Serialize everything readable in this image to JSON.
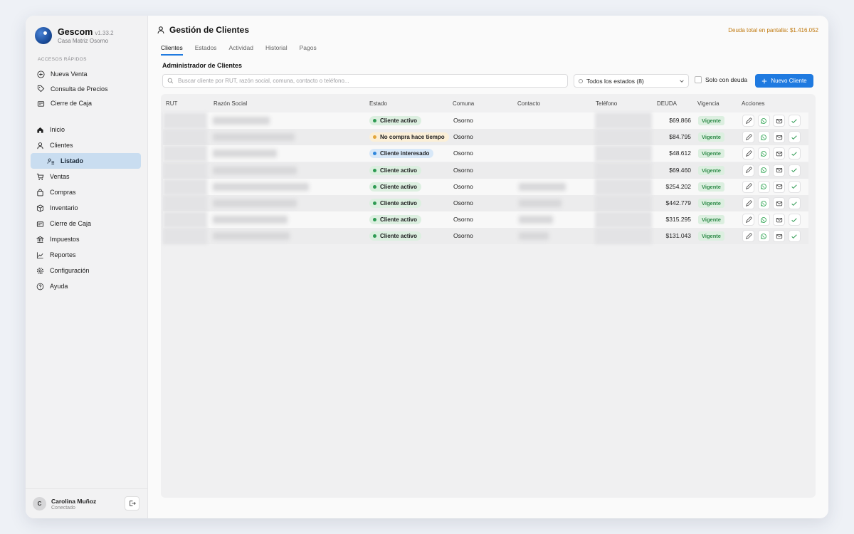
{
  "app": {
    "name": "Gescom",
    "version": "v1.33.2",
    "branch": "Casa Matriz Osorno"
  },
  "quick_access": {
    "title": "ACCESOS RÁPIDOS",
    "items": [
      {
        "label": "Nueva Venta",
        "icon": "plus-circle-icon"
      },
      {
        "label": "Consulta de Precios",
        "icon": "tag-icon"
      },
      {
        "label": "Cierre de Caja",
        "icon": "cash-register-icon"
      }
    ]
  },
  "nav": {
    "items": [
      {
        "label": "Inicio",
        "icon": "home-icon"
      },
      {
        "label": "Clientes",
        "icon": "user-icon"
      },
      {
        "label": "Listado",
        "icon": "users-list-icon",
        "active": true
      },
      {
        "label": "Ventas",
        "icon": "cart-icon"
      },
      {
        "label": "Compras",
        "icon": "shopping-bag-icon"
      },
      {
        "label": "Inventario",
        "icon": "box-icon"
      },
      {
        "label": "Cierre de Caja",
        "icon": "cash-register-icon"
      },
      {
        "label": "Impuestos",
        "icon": "bank-icon"
      },
      {
        "label": "Reportes",
        "icon": "chart-line-icon"
      },
      {
        "label": "Configuración",
        "icon": "gear-icon"
      },
      {
        "label": "Ayuda",
        "icon": "help-circle-icon"
      }
    ]
  },
  "user": {
    "initial": "C",
    "name": "Carolina Muñoz",
    "status": "Conectado"
  },
  "header": {
    "title": "Gestión de Clientes",
    "debt_total": "Deuda total en pantalla: $1.416.052",
    "tabs": [
      "Clientes",
      "Estados",
      "Actividad",
      "Historial",
      "Pagos"
    ],
    "active_tab": "Clientes"
  },
  "toolbar": {
    "subtitle": "Administrador de Clientes",
    "search_placeholder": "Buscar cliente por RUT, razón social, comuna, contacto o teléfono...",
    "status_filter": "Todos los estados (8)",
    "debt_only_label": "Solo con deuda",
    "new_button": "Nuevo Cliente"
  },
  "table": {
    "columns": [
      "RUT",
      "Razón Social",
      "Estado",
      "Comuna",
      "Contacto",
      "Teléfono",
      "DEUDA",
      "Vigencia",
      "Acciones"
    ],
    "rows": [
      {
        "estado": "Cliente activo",
        "estado_kind": "activo",
        "comuna": "Osorno",
        "deuda": "$69.866",
        "vigencia": "Vigente"
      },
      {
        "estado": "No compra hace tiempo",
        "estado_kind": "nocompra",
        "comuna": "Osorno",
        "deuda": "$84.795",
        "vigencia": "Vigente"
      },
      {
        "estado": "Cliente interesado",
        "estado_kind": "interes",
        "comuna": "Osorno",
        "deuda": "$48.612",
        "vigencia": "Vigente"
      },
      {
        "estado": "Cliente activo",
        "estado_kind": "activo",
        "comuna": "Osorno",
        "deuda": "$69.460",
        "vigencia": "Vigente"
      },
      {
        "estado": "Cliente activo",
        "estado_kind": "activo",
        "comuna": "Osorno",
        "deuda": "$254.202",
        "vigencia": "Vigente"
      },
      {
        "estado": "Cliente activo",
        "estado_kind": "activo",
        "comuna": "Osorno",
        "deuda": "$442.779",
        "vigencia": "Vigente"
      },
      {
        "estado": "Cliente activo",
        "estado_kind": "activo",
        "comuna": "Osorno",
        "deuda": "$315.295",
        "vigencia": "Vigente"
      },
      {
        "estado": "Cliente activo",
        "estado_kind": "activo",
        "comuna": "Osorno",
        "deuda": "$131.043",
        "vigencia": "Vigente"
      }
    ],
    "row_actions": [
      "edit-icon",
      "whatsapp-icon",
      "mail-icon",
      "check-icon"
    ]
  },
  "colors": {
    "accent": "#1f7ae0",
    "debt_total": "#c07a10",
    "active_green": "#2e9a52",
    "warning_orange": "#e2a53a",
    "info_blue": "#2f86dc"
  }
}
